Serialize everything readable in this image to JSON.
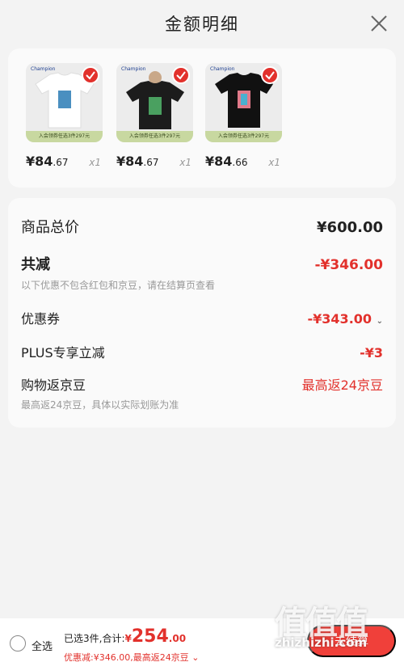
{
  "header": {
    "title": "金额明细"
  },
  "products": [
    {
      "brand": "Champion",
      "promo": "入会领券任选3件297元",
      "price_int": "¥84",
      "price_dec": ".67",
      "qty": "x1",
      "shirt_color": "#ffffff",
      "print_color": "#4a8fc0"
    },
    {
      "brand": "Champion",
      "promo": "入会领券任选3件297元",
      "price_int": "¥84",
      "price_dec": ".67",
      "qty": "x1",
      "shirt_color": "#1c1c1c",
      "print_color": "#4aa060"
    },
    {
      "brand": "Champion",
      "promo": "入会领券任选3件297元",
      "price_int": "¥84",
      "price_dec": ".66",
      "qty": "x1",
      "shirt_color": "#111111",
      "print_color": "#e07a8a"
    }
  ],
  "summary": {
    "total_label": "商品总价",
    "total_value": "¥600.00",
    "reduce_label": "共减",
    "reduce_value": "-¥346.00",
    "reduce_note": "以下优惠不包含红包和京豆，请在结算页查看",
    "coupon_label": "优惠券",
    "coupon_value": "-¥343.00",
    "plus_label": "PLUS专享立减",
    "plus_value": "-¥3",
    "beans_label": "购物返京豆",
    "beans_value": "最高返24京豆",
    "beans_note": "最高返24京豆，具体以实际划账为准"
  },
  "bottom": {
    "select_all": "全选",
    "selected_text": "已选3件,合计:",
    "total_currency": "¥",
    "total_int": "254",
    "total_dec": ".00",
    "discount_text": "优惠减:¥346.00,最高返24京豆",
    "checkout": "去结算"
  },
  "watermark": {
    "logo": "值值值",
    "url": "zhizhizhi.com"
  },
  "colors": {
    "accent": "#e2312c",
    "background": "#f3f3f3",
    "card": "#fafafa"
  }
}
